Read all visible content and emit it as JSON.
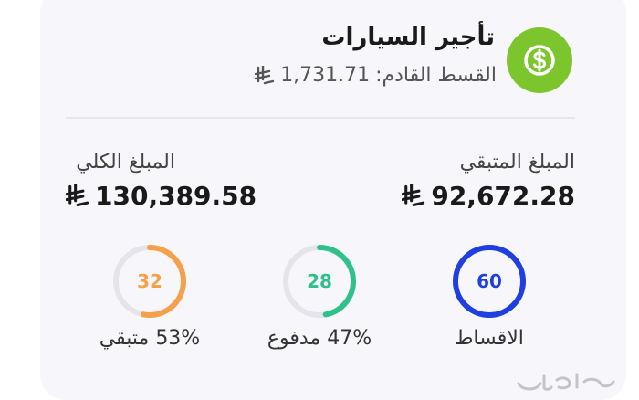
{
  "header": {
    "title": "تأجير السيارات",
    "next_installment_label": "القسط القادم:",
    "next_installment_value": "1,731.71",
    "icon": "dollar-coin-icon",
    "icon_color": "#7dc52c"
  },
  "summary": {
    "remaining_label": "المبلغ المتبقي",
    "remaining_value": "92,672.28",
    "total_label": "المبلغ الكلي",
    "total_value": "130,389.58"
  },
  "rings": {
    "installments": {
      "number": "60",
      "caption": "الاقساط",
      "fraction": 1.0,
      "color": "#1f3fe0"
    },
    "paid": {
      "number": "28",
      "caption": "47% مدفوع",
      "fraction": 0.47,
      "color": "#2ec28a"
    },
    "remaining": {
      "number": "32",
      "caption": "53% متبقي",
      "fraction": 0.53,
      "color": "#f5a04a"
    }
  },
  "watermark": "harajicon"
}
